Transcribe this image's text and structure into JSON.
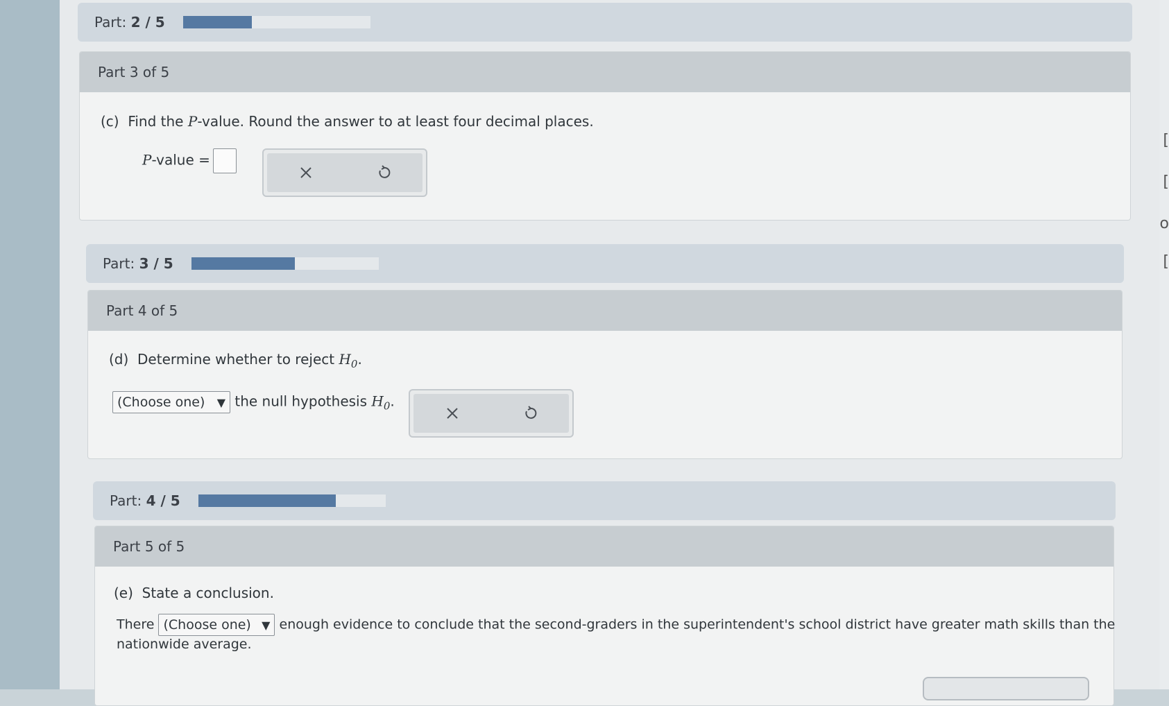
{
  "progress": [
    {
      "label": "Part:",
      "value": "2 / 5",
      "fraction": 0.4
    },
    {
      "label": "Part:",
      "value": "3 / 5",
      "fraction": 0.6
    },
    {
      "label": "Part:",
      "value": "4 / 5",
      "fraction": 0.8
    }
  ],
  "parts": [
    {
      "header": "Part 3 of 5",
      "prefix": "(c)",
      "question_pre": "Find the ",
      "question_var": "P",
      "question_post": "-value. Round the answer to at least four decimal places.",
      "answer_var": "P",
      "answer_label": "-value =",
      "answer_value": ""
    },
    {
      "header": "Part 4 of 5",
      "prefix": "(d)",
      "question_pre": "Determine whether to reject ",
      "hyp_var": "H",
      "hyp_sub": "0",
      "question_post": ".",
      "select_value": "(Choose one)",
      "select_arrow": "▼",
      "after_select": "the null hypothesis ",
      "after_post": "."
    },
    {
      "header": "Part 5 of 5",
      "prefix": "(e)",
      "question": "State a conclusion.",
      "before_select": "There",
      "select_value": "(Choose one)",
      "select_arrow": "▼",
      "after_select": "enough evidence to conclude that the second-graders in the superintendent's school district have greater math skills than the",
      "continuation": "nationwide average."
    }
  ],
  "tools": {
    "clear_symbol": "×",
    "undo_symbol": "↺"
  },
  "icons": [
    "close-icon",
    "undo-icon",
    "dropdown-arrow-icon"
  ],
  "colors": {
    "progress_fill": "#5579a2",
    "banner_bg": "#d0d8df",
    "header_bg": "#c7cdd1"
  }
}
